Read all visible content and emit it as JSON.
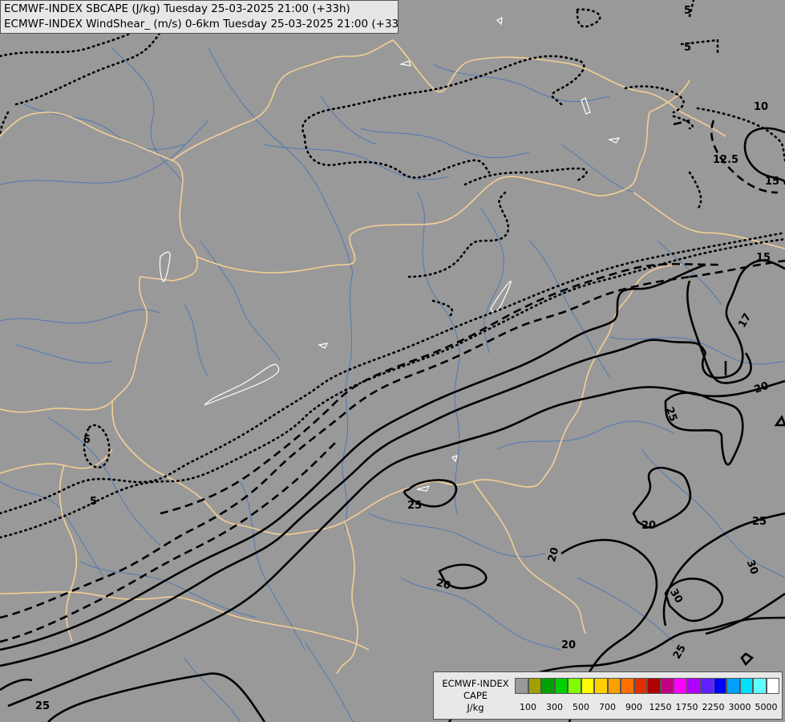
{
  "titles": {
    "line1": "ECMWF-INDEX SBCAPE (J/kg) Tuesday 25-03-2025 21:00 (+33h)",
    "line2": "ECMWF-INDEX WindShear_ (m/s) 0-6km Tuesday 25-03-2025 21:00 (+33h)"
  },
  "colors": {
    "background": "#999999",
    "borders": "#f4cf95",
    "rivers": "#4f79b3",
    "contours": "#000000",
    "lakes": "#ffffff"
  },
  "contour_labels": [
    "5",
    "5",
    "10",
    "12.5",
    "15",
    "15",
    "17",
    "20",
    "25",
    "5",
    "5",
    "25",
    "20",
    "20",
    "25",
    "30",
    "30",
    "20",
    "25",
    "20",
    "25"
  ],
  "legend": {
    "title_lines": [
      "ECMWF-INDEX",
      "CAPE",
      "J/kg"
    ],
    "swatch_colors": [
      "#999999",
      "#a0a000",
      "#00a000",
      "#00d000",
      "#80ff00",
      "#ffff00",
      "#ffd000",
      "#ffa000",
      "#ff7000",
      "#e03000",
      "#b00000",
      "#c00080",
      "#ff00ff",
      "#b000ff",
      "#6020ff",
      "#0000ff",
      "#00a0ff",
      "#00e0ff",
      "#60ffff",
      "#ffffff"
    ],
    "ticks": [
      "100",
      "300",
      "500",
      "700",
      "900",
      "1250",
      "1750",
      "2250",
      "3000",
      "5000"
    ]
  }
}
